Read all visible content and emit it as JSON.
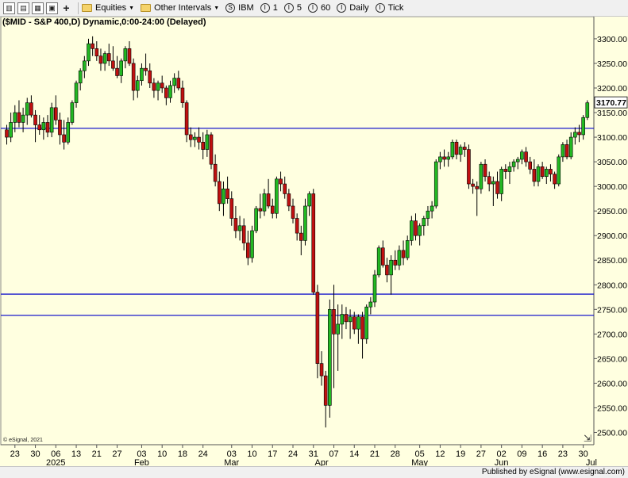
{
  "toolbar": {
    "icons": [
      "chart-style-icon",
      "new-page-icon",
      "layout-icon",
      "print-icon",
      "add-icon"
    ],
    "equities_label": "Equities",
    "intervals_label": "Other Intervals",
    "symbol_label": "IBM",
    "interval_buttons": [
      "1",
      "5",
      "60",
      "Daily",
      "Tick"
    ]
  },
  "footer": {
    "published": "Published by eSignal (www.esignal.com)"
  },
  "credit": "© eSignal, 2021",
  "colors": {
    "up": "#22b822",
    "down": "#c01010",
    "line": "#1a1acc",
    "bg": "#ffffe0",
    "wick": "#000000"
  },
  "chart_data": {
    "type": "candlestick",
    "title": "($MID - S&P 400,D) Dynamic,0:00-24:00 (Delayed)",
    "ylim": [
      2475,
      3345
    ],
    "y_ticks": [
      2500,
      2550,
      2600,
      2650,
      2700,
      2750,
      2800,
      2850,
      2900,
      2950,
      3000,
      3050,
      3100,
      3150,
      3200,
      3250,
      3300
    ],
    "last_price_label": "3170.77",
    "horizontal_lines": [
      3118,
      2781,
      2738
    ],
    "x_ticks": [
      "23",
      "30",
      "06",
      "13",
      "21",
      "27",
      "03",
      "10",
      "18",
      "24",
      "03",
      "10",
      "17",
      "24",
      "31",
      "07",
      "14",
      "21",
      "28",
      "05",
      "12",
      "19",
      "27",
      "02",
      "09",
      "16",
      "23",
      "30"
    ],
    "x_tick_bar_index": [
      2,
      7,
      12,
      17,
      22,
      27,
      33,
      38,
      43,
      48,
      55,
      60,
      65,
      70,
      75,
      80,
      85,
      90,
      95,
      101,
      106,
      111,
      116,
      121,
      126,
      131,
      136,
      141
    ],
    "x_labels_lower": [
      {
        "label": "2025",
        "bar": 12
      },
      {
        "label": "Feb",
        "bar": 33
      },
      {
        "label": "Mar",
        "bar": 55
      },
      {
        "label": "Apr",
        "bar": 77
      },
      {
        "label": "May",
        "bar": 101
      },
      {
        "label": "Jun",
        "bar": 121
      },
      {
        "label": "Jul",
        "bar": 143
      }
    ],
    "ohlc": [
      [
        3115,
        3125,
        3085,
        3100
      ],
      [
        3100,
        3150,
        3090,
        3130
      ],
      [
        3130,
        3165,
        3110,
        3150
      ],
      [
        3150,
        3175,
        3120,
        3130
      ],
      [
        3130,
        3160,
        3110,
        3145
      ],
      [
        3145,
        3180,
        3125,
        3170
      ],
      [
        3170,
        3185,
        3140,
        3145
      ],
      [
        3145,
        3155,
        3090,
        3125
      ],
      [
        3125,
        3145,
        3105,
        3115
      ],
      [
        3115,
        3140,
        3095,
        3130
      ],
      [
        3130,
        3145,
        3100,
        3110
      ],
      [
        3110,
        3170,
        3100,
        3160
      ],
      [
        3160,
        3185,
        3125,
        3135
      ],
      [
        3135,
        3150,
        3085,
        3105
      ],
      [
        3105,
        3135,
        3075,
        3090
      ],
      [
        3090,
        3140,
        3085,
        3130
      ],
      [
        3130,
        3175,
        3125,
        3170
      ],
      [
        3170,
        3215,
        3160,
        3210
      ],
      [
        3210,
        3240,
        3195,
        3235
      ],
      [
        3235,
        3265,
        3220,
        3255
      ],
      [
        3255,
        3300,
        3245,
        3290
      ],
      [
        3290,
        3305,
        3265,
        3280
      ],
      [
        3280,
        3295,
        3255,
        3265
      ],
      [
        3265,
        3280,
        3235,
        3250
      ],
      [
        3250,
        3275,
        3235,
        3270
      ],
      [
        3270,
        3290,
        3245,
        3255
      ],
      [
        3255,
        3285,
        3235,
        3240
      ],
      [
        3240,
        3265,
        3220,
        3225
      ],
      [
        3225,
        3260,
        3210,
        3255
      ],
      [
        3255,
        3285,
        3240,
        3280
      ],
      [
        3280,
        3295,
        3245,
        3250
      ],
      [
        3250,
        3260,
        3175,
        3195
      ],
      [
        3195,
        3225,
        3180,
        3215
      ],
      [
        3215,
        3250,
        3205,
        3240
      ],
      [
        3240,
        3270,
        3225,
        3235
      ],
      [
        3235,
        3250,
        3200,
        3210
      ],
      [
        3210,
        3220,
        3180,
        3195
      ],
      [
        3195,
        3215,
        3175,
        3210
      ],
      [
        3210,
        3225,
        3190,
        3200
      ],
      [
        3200,
        3205,
        3165,
        3180
      ],
      [
        3180,
        3215,
        3170,
        3205
      ],
      [
        3205,
        3230,
        3190,
        3220
      ],
      [
        3220,
        3235,
        3195,
        3200
      ],
      [
        3200,
        3215,
        3160,
        3170
      ],
      [
        3170,
        3175,
        3090,
        3105
      ],
      [
        3105,
        3120,
        3080,
        3095
      ],
      [
        3095,
        3110,
        3080,
        3100
      ],
      [
        3100,
        3120,
        3075,
        3090
      ],
      [
        3090,
        3110,
        3055,
        3075
      ],
      [
        3075,
        3115,
        3060,
        3105
      ],
      [
        3105,
        3110,
        3035,
        3045
      ],
      [
        3045,
        3065,
        3000,
        3010
      ],
      [
        3010,
        3030,
        2950,
        2965
      ],
      [
        2965,
        3010,
        2940,
        2995
      ],
      [
        2995,
        3020,
        2965,
        2975
      ],
      [
        2975,
        2990,
        2920,
        2935
      ],
      [
        2935,
        2960,
        2895,
        2910
      ],
      [
        2910,
        2940,
        2890,
        2920
      ],
      [
        2920,
        2935,
        2870,
        2885
      ],
      [
        2885,
        2910,
        2840,
        2855
      ],
      [
        2855,
        2920,
        2845,
        2910
      ],
      [
        2910,
        2960,
        2905,
        2955
      ],
      [
        2955,
        2985,
        2935,
        2950
      ],
      [
        2950,
        2995,
        2940,
        2985
      ],
      [
        2985,
        3015,
        2955,
        2960
      ],
      [
        2960,
        2975,
        2935,
        2945
      ],
      [
        2945,
        3020,
        2935,
        3015
      ],
      [
        3015,
        3030,
        2990,
        3005
      ],
      [
        3005,
        3020,
        2975,
        2985
      ],
      [
        2985,
        2995,
        2950,
        2960
      ],
      [
        2960,
        2975,
        2925,
        2935
      ],
      [
        2935,
        2945,
        2890,
        2905
      ],
      [
        2905,
        2920,
        2860,
        2890
      ],
      [
        2890,
        2975,
        2880,
        2960
      ],
      [
        2960,
        2990,
        2940,
        2985
      ],
      [
        2985,
        2995,
        2780,
        2785
      ],
      [
        2785,
        2800,
        2610,
        2640
      ],
      [
        2640,
        2665,
        2595,
        2615
      ],
      [
        2615,
        2625,
        2510,
        2555
      ],
      [
        2555,
        2770,
        2530,
        2750
      ],
      [
        2750,
        2800,
        2590,
        2700
      ],
      [
        2700,
        2760,
        2625,
        2720
      ],
      [
        2720,
        2760,
        2690,
        2740
      ],
      [
        2740,
        2755,
        2710,
        2725
      ],
      [
        2725,
        2750,
        2690,
        2735
      ],
      [
        2735,
        2745,
        2700,
        2710
      ],
      [
        2710,
        2740,
        2680,
        2735
      ],
      [
        2735,
        2745,
        2650,
        2690
      ],
      [
        2690,
        2760,
        2680,
        2755
      ],
      [
        2755,
        2775,
        2740,
        2765
      ],
      [
        2765,
        2830,
        2755,
        2820
      ],
      [
        2820,
        2880,
        2815,
        2875
      ],
      [
        2875,
        2890,
        2835,
        2840
      ],
      [
        2840,
        2855,
        2805,
        2820
      ],
      [
        2820,
        2860,
        2780,
        2850
      ],
      [
        2850,
        2870,
        2830,
        2840
      ],
      [
        2840,
        2880,
        2830,
        2870
      ],
      [
        2870,
        2890,
        2840,
        2855
      ],
      [
        2855,
        2900,
        2850,
        2890
      ],
      [
        2890,
        2940,
        2880,
        2930
      ],
      [
        2930,
        2945,
        2890,
        2900
      ],
      [
        2900,
        2925,
        2880,
        2920
      ],
      [
        2920,
        2940,
        2900,
        2935
      ],
      [
        2935,
        2960,
        2920,
        2950
      ],
      [
        2950,
        2970,
        2935,
        2960
      ],
      [
        2960,
        3055,
        2955,
        3050
      ],
      [
        3050,
        3070,
        3035,
        3060
      ],
      [
        3060,
        3075,
        3040,
        3055
      ],
      [
        3055,
        3070,
        3040,
        3060
      ],
      [
        3060,
        3095,
        3055,
        3090
      ],
      [
        3090,
        3095,
        3055,
        3065
      ],
      [
        3065,
        3085,
        3050,
        3080
      ],
      [
        3080,
        3090,
        3060,
        3075
      ],
      [
        3075,
        3085,
        2995,
        3005
      ],
      [
        3005,
        3015,
        2985,
        3000
      ],
      [
        3000,
        3010,
        2940,
        2995
      ],
      [
        2995,
        3050,
        2985,
        3045
      ],
      [
        3045,
        3055,
        3010,
        3020
      ],
      [
        3020,
        3030,
        2990,
        3005
      ],
      [
        3005,
        3020,
        2960,
        3010
      ],
      [
        3010,
        3030,
        2975,
        2985
      ],
      [
        2985,
        3040,
        2970,
        3035
      ],
      [
        3035,
        3045,
        3015,
        3030
      ],
      [
        3030,
        3050,
        3005,
        3040
      ],
      [
        3040,
        3055,
        3030,
        3050
      ],
      [
        3050,
        3060,
        3035,
        3055
      ],
      [
        3055,
        3075,
        3045,
        3070
      ],
      [
        3070,
        3080,
        3040,
        3050
      ],
      [
        3050,
        3060,
        3025,
        3035
      ],
      [
        3035,
        3055,
        3000,
        3010
      ],
      [
        3010,
        3045,
        3000,
        3040
      ],
      [
        3040,
        3050,
        3015,
        3020
      ],
      [
        3020,
        3040,
        3005,
        3035
      ],
      [
        3035,
        3045,
        3010,
        3025
      ],
      [
        3025,
        3030,
        2995,
        3005
      ],
      [
        3005,
        3065,
        3000,
        3060
      ],
      [
        3060,
        3090,
        3050,
        3085
      ],
      [
        3085,
        3095,
        3055,
        3060
      ],
      [
        3060,
        3110,
        3055,
        3100
      ],
      [
        3100,
        3120,
        3085,
        3110
      ],
      [
        3110,
        3125,
        3090,
        3105
      ],
      [
        3105,
        3145,
        3095,
        3140
      ],
      [
        3140,
        3175,
        3135,
        3170
      ]
    ]
  }
}
